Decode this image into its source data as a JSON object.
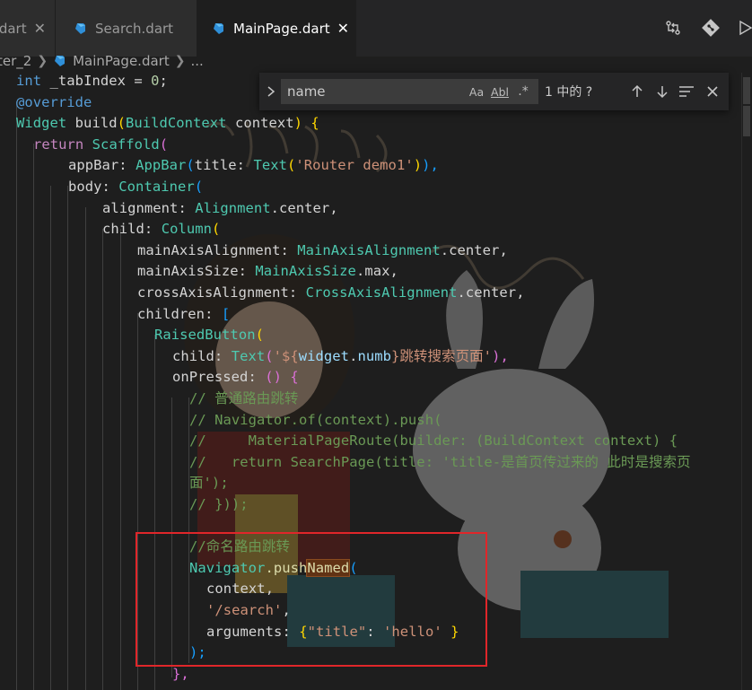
{
  "tabs": [
    {
      "label": "dart",
      "close": "✕"
    },
    {
      "label": "Search.dart",
      "close": ""
    },
    {
      "label": "MainPage.dart",
      "close": "✕",
      "active": true
    }
  ],
  "breadcrumb": {
    "items": [
      "ter_2",
      "MainPage.dart",
      "..."
    ]
  },
  "find": {
    "query": "name",
    "match_case": "Aa",
    "whole_word": "Abl",
    "regex": ".*",
    "match_count": "1 中的 ?",
    "prev_icon": "arrow-up-icon",
    "next_icon": "arrow-down-icon",
    "selection_icon": "find-in-selection-icon",
    "close_icon": "close-icon"
  },
  "colors": {
    "highlight_box": "#e0262a",
    "editor_bg": "#1e1e1e",
    "tab_active_bg": "#1e1e1e",
    "tab_inactive_bg": "#2d2d2d"
  },
  "code": {
    "l1": {
      "a": "int",
      "b": " _tabIndex ",
      "c": "= ",
      "d": "0",
      "e": ";"
    },
    "l2": {
      "a": "@override"
    },
    "l3": {
      "a": "Widget",
      "b": " build",
      "c": "(",
      "d": "BuildContext",
      "e": " context",
      "f": ")",
      "g": " {"
    },
    "l4": {
      "a": "return",
      "b": " Scaffold",
      "c": "("
    },
    "l5": {
      "a": "appBar",
      "b": ": ",
      "c": "AppBar",
      "d": "(",
      "e": "title",
      "f": ": ",
      "g": "Text",
      "h": "(",
      "i": "'Router demo1'",
      "j": ")",
      "k": "),"
    },
    "l6": {
      "a": "body",
      "b": ": ",
      "c": "Container",
      "d": "("
    },
    "l7": {
      "a": "alignment",
      "b": ": ",
      "c": "Alignment",
      "d": ".center,"
    },
    "l8": {
      "a": "child",
      "b": ": ",
      "c": "Column",
      "d": "("
    },
    "l9": {
      "a": "mainAxisAlignment",
      "b": ": ",
      "c": "MainAxisAlignment",
      "d": ".center,"
    },
    "l10": {
      "a": "mainAxisSize",
      "b": ": ",
      "c": "MainAxisSize",
      "d": ".max,"
    },
    "l11": {
      "a": "crossAxisAlignment",
      "b": ": ",
      "c": "CrossAxisAlignment",
      "d": ".center,"
    },
    "l12": {
      "a": "children",
      "b": ": ",
      "c": "["
    },
    "l13": {
      "a": "RaisedButton",
      "b": "("
    },
    "l14": {
      "a": "child",
      "b": ": ",
      "c": "Text",
      "d": "(",
      "e": "'${",
      "f": "widget",
      "g": ".",
      "h": "numb",
      "i": "}跳转搜索页面'",
      "j": "),"
    },
    "l15": {
      "a": "onPressed",
      "b": ": ",
      "c": "()",
      "d": " {"
    },
    "l16": {
      "a": "// 普通路由跳转"
    },
    "l17": {
      "a": "// Navigator.of(context).push("
    },
    "l18": {
      "a": "//     MaterialPageRoute(builder: (BuildContext context) {"
    },
    "l19": {
      "a": "//   return SearchPage(title: 'title-是首页传过来的 此时是搜索页"
    },
    "l20": {
      "a": "面');"
    },
    "l21": {
      "a": "// }));"
    },
    "l22": {
      "a": "//命名路由跳转"
    },
    "l23": {
      "a": "Navigator",
      "b": ".push",
      "c": "Named",
      "d": "("
    },
    "l24": {
      "a": "context",
      "b": ","
    },
    "l25": {
      "a": "'/search'",
      "b": ","
    },
    "l26": {
      "a": "arguments",
      "b": ": ",
      "c": "{",
      "d": "\"title\"",
      "e": ": ",
      "f": "'hello'",
      "g": " }"
    },
    "l27": {
      "a": ");"
    },
    "l28": {
      "a": "},"
    }
  }
}
